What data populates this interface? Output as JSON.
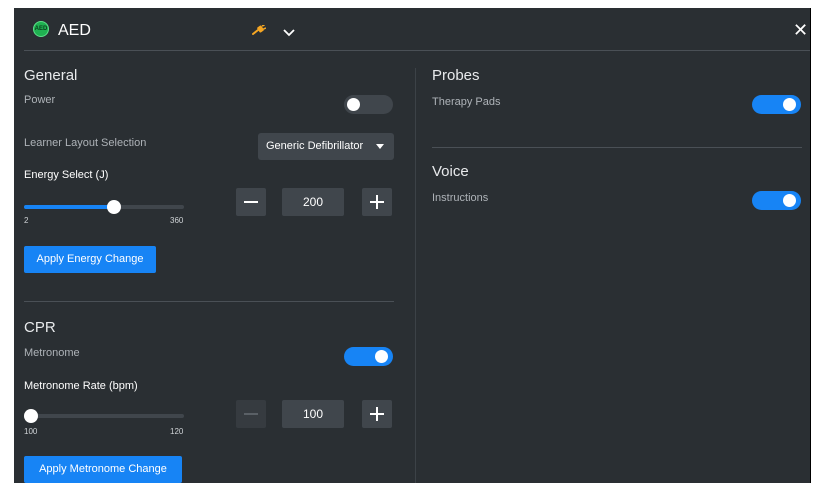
{
  "header": {
    "logo_text": "AED",
    "title": "AED",
    "close_glyph": "✕",
    "plug_icon": "plug-icon",
    "chevron_icon": "chevron-down-icon"
  },
  "general": {
    "title": "General",
    "power": {
      "label": "Power",
      "on": false
    },
    "layout": {
      "label": "Learner Layout Selection",
      "selected": "Generic Defibrillator"
    },
    "energy": {
      "label": "Energy Select (J)",
      "min": "2",
      "max": "360",
      "value": "200",
      "level": 0.56,
      "apply_label": "Apply Energy Change"
    }
  },
  "cpr": {
    "title": "CPR",
    "metronome": {
      "label": "Metronome",
      "on": true
    },
    "rate": {
      "label": "Metronome Rate (bpm)",
      "min": "100",
      "max": "120",
      "value": "100",
      "level": 0.0,
      "apply_label": "Apply Metronome Change"
    }
  },
  "probes": {
    "title": "Probes",
    "therapy_pads": {
      "label": "Therapy Pads",
      "on": true
    }
  },
  "voice": {
    "title": "Voice",
    "instructions": {
      "label": "Instructions",
      "on": true
    }
  },
  "colors": {
    "panel_bg": "#2a2f33",
    "accent": "#1784f5",
    "control_bg": "#40464c",
    "logo_green": "#1fb151",
    "plug_orange": "#f5a623"
  }
}
